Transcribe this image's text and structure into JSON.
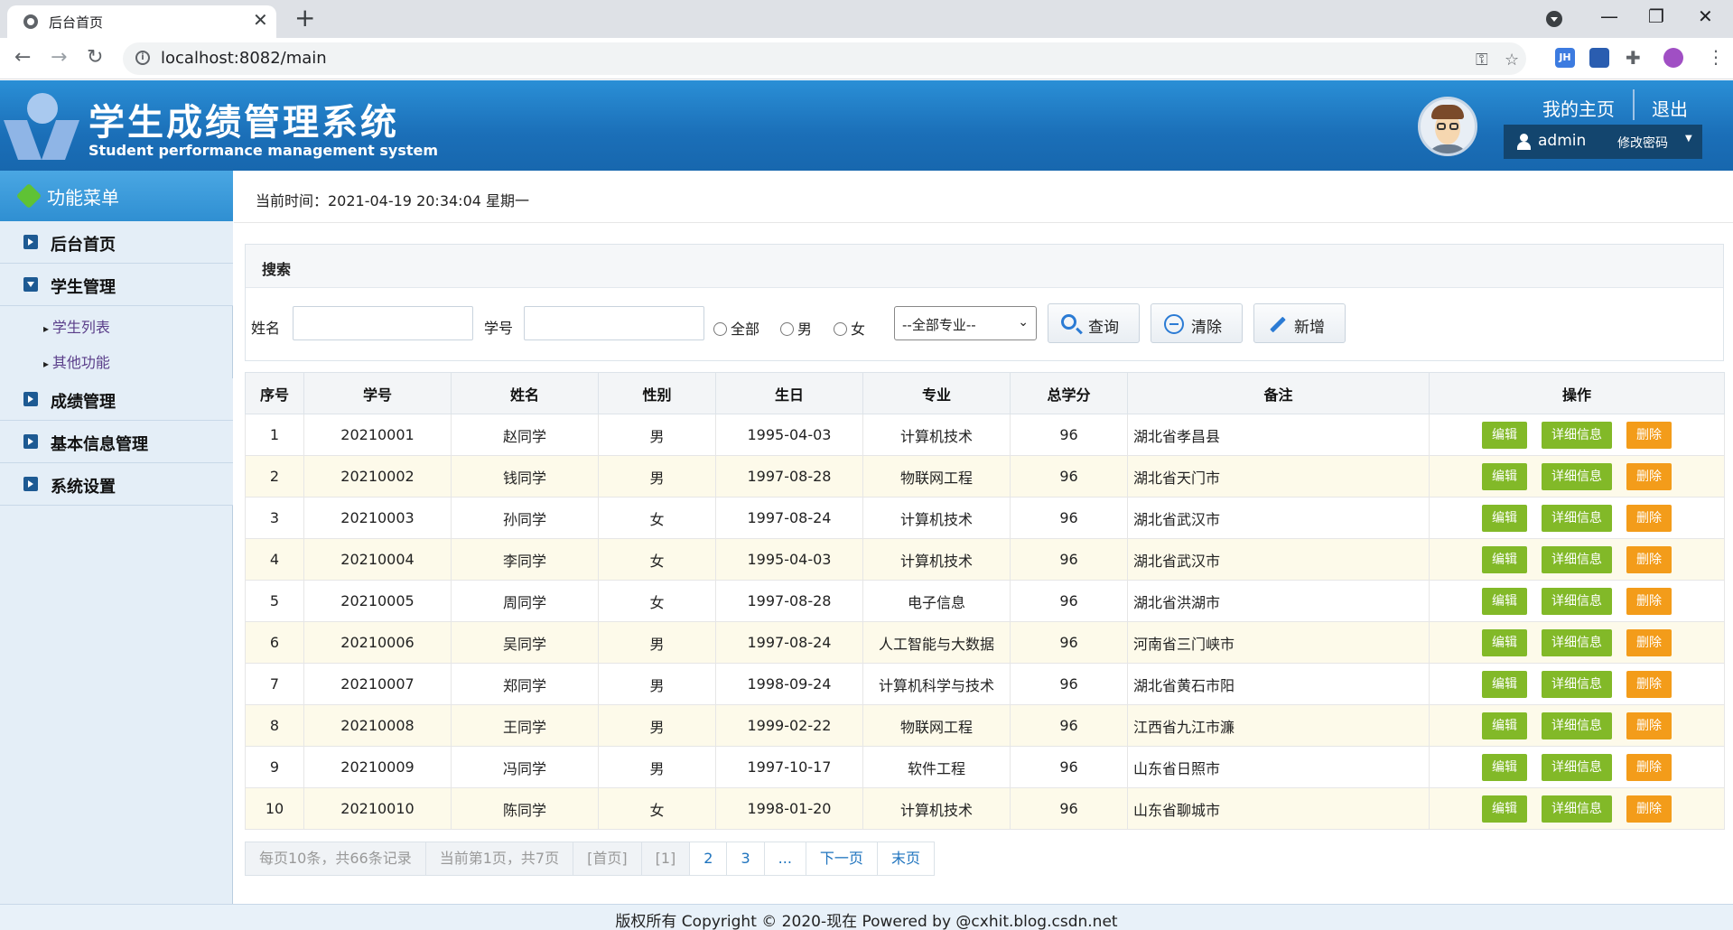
{
  "browser": {
    "tab_title": "后台首页",
    "close_glyph": "✕",
    "new_tab_glyph": "+",
    "url": "localhost:8082/main",
    "window_controls": [
      "—",
      "❐",
      "✕"
    ],
    "nav": [
      "←",
      "→",
      "↻"
    ],
    "ext_jh": "JH"
  },
  "app": {
    "title": "学生成绩管理系统",
    "subtitle": "Student performance management system",
    "my_home": "我的主页",
    "logout": "退出",
    "username": "admin",
    "change_password": "修改密码",
    "caret": "▼"
  },
  "sidebar": {
    "header": "功能菜单",
    "items": [
      {
        "label": "后台首页"
      },
      {
        "label": "学生管理"
      },
      {
        "label": "成绩管理"
      },
      {
        "label": "基本信息管理"
      },
      {
        "label": "系统设置"
      }
    ],
    "subitems": [
      {
        "label": "学生列表"
      },
      {
        "label": "其他功能"
      }
    ]
  },
  "main": {
    "current_time": "当前时间：2021-04-19 20:34:04 星期一",
    "search": {
      "panel_title": "搜索",
      "name_label": "姓名",
      "id_label": "学号",
      "radio_all": "全部",
      "radio_male": "男",
      "radio_female": "女",
      "major_select": "--全部专业--",
      "query_button": "查询",
      "clear_button": "清除",
      "add_button": "新增"
    },
    "table": {
      "headers": [
        "序号",
        "学号",
        "姓名",
        "性别",
        "生日",
        "专业",
        "总学分",
        "备注",
        "操作"
      ],
      "actions": {
        "edit": "编辑",
        "detail": "详细信息",
        "delete": "删除"
      },
      "rows": [
        [
          "1",
          "20210001",
          "赵同学",
          "男",
          "1995-04-03",
          "计算机技术",
          "96",
          "湖北省孝昌县"
        ],
        [
          "2",
          "20210002",
          "钱同学",
          "男",
          "1997-08-28",
          "物联网工程",
          "96",
          "湖北省天门市"
        ],
        [
          "3",
          "20210003",
          "孙同学",
          "女",
          "1997-08-24",
          "计算机技术",
          "96",
          "湖北省武汉市"
        ],
        [
          "4",
          "20210004",
          "李同学",
          "女",
          "1995-04-03",
          "计算机技术",
          "96",
          "湖北省武汉市"
        ],
        [
          "5",
          "20210005",
          "周同学",
          "女",
          "1997-08-28",
          "电子信息",
          "96",
          "湖北省洪湖市"
        ],
        [
          "6",
          "20210006",
          "吴同学",
          "男",
          "1997-08-24",
          "人工智能与大数据",
          "96",
          "河南省三门峡市"
        ],
        [
          "7",
          "20210007",
          "郑同学",
          "男",
          "1998-09-24",
          "计算机科学与技术",
          "96",
          "湖北省黄石市阳"
        ],
        [
          "8",
          "20210008",
          "王同学",
          "男",
          "1999-02-22",
          "物联网工程",
          "96",
          "江西省九江市濂"
        ],
        [
          "9",
          "20210009",
          "冯同学",
          "男",
          "1997-10-17",
          "软件工程",
          "96",
          "山东省日照市"
        ],
        [
          "10",
          "20210010",
          "陈同学",
          "女",
          "1998-01-20",
          "计算机技术",
          "96",
          "山东省聊城市"
        ]
      ]
    },
    "pager": {
      "summary": "每页10条，共66条记录",
      "current": "当前第1页，共7页",
      "first": "[首页]",
      "page1": "[1]",
      "page2": "2",
      "page3": "3",
      "ellipsis": "...",
      "next": "下一页",
      "last": "末页"
    }
  },
  "footer": {
    "text": "版权所有 Copyright © 2020-现在 Powered by @cxhit.blog.csdn.net"
  },
  "colors": {
    "header_blue": "#1b6fb8",
    "edit_green": "#82b928",
    "delete_orange": "#f39c1a"
  }
}
